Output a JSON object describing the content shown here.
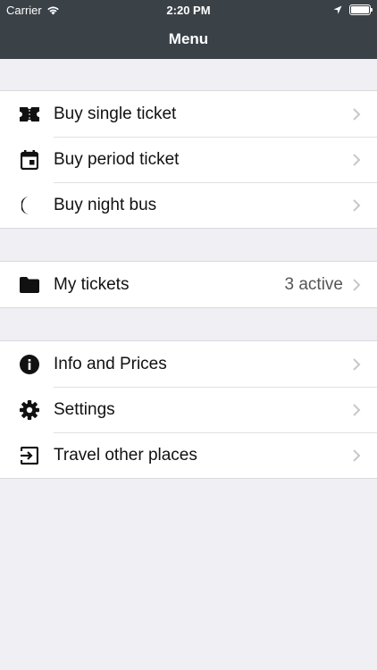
{
  "status_bar": {
    "carrier": "Carrier",
    "time": "2:20 PM"
  },
  "nav": {
    "title": "Menu"
  },
  "groups": [
    {
      "items": [
        {
          "label": "Buy single ticket",
          "icon": "ticket-icon"
        },
        {
          "label": "Buy period ticket",
          "icon": "calendar-icon"
        },
        {
          "label": "Buy night bus",
          "icon": "moon-icon"
        }
      ]
    },
    {
      "items": [
        {
          "label": "My tickets",
          "value": "3 active",
          "icon": "folder-icon"
        }
      ]
    },
    {
      "items": [
        {
          "label": "Info and Prices",
          "icon": "info-icon"
        },
        {
          "label": "Settings",
          "icon": "gear-icon"
        },
        {
          "label": "Travel other places",
          "icon": "exit-icon"
        }
      ]
    }
  ],
  "colors": {
    "header_bg": "#3a4147",
    "page_bg": "#efeff4",
    "row_bg": "#ffffff"
  }
}
